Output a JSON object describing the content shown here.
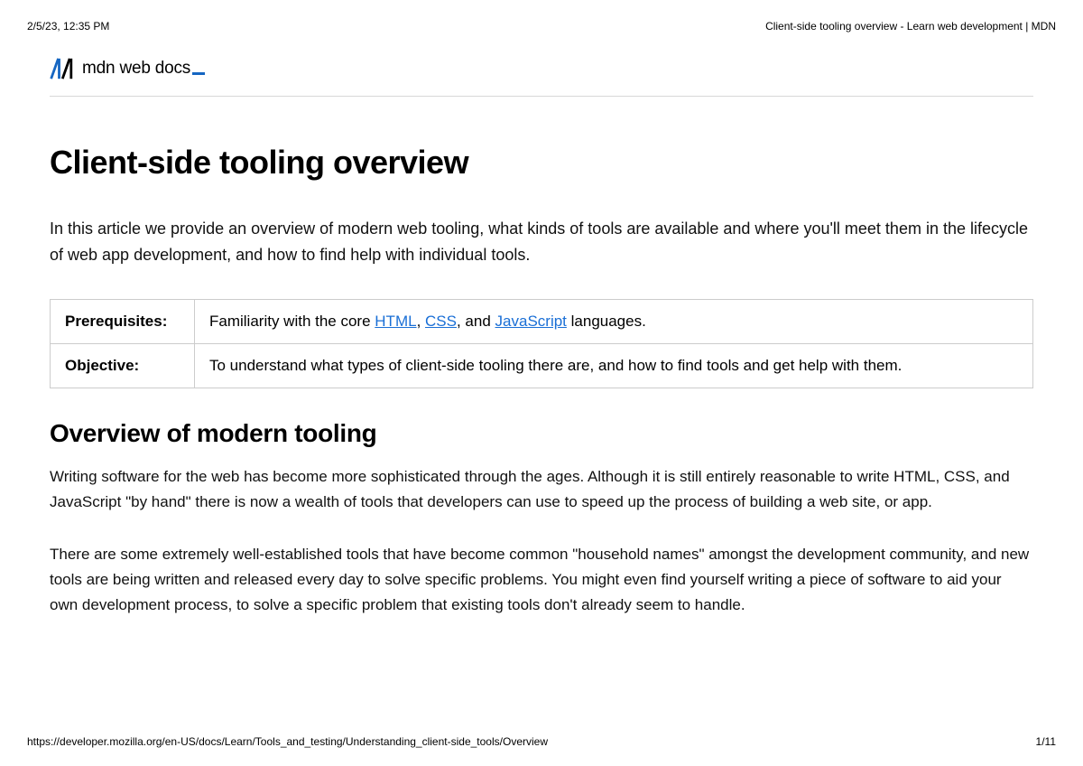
{
  "print_header": {
    "timestamp": "2/5/23, 12:35 PM",
    "doc_title": "Client-side tooling overview - Learn web development | MDN"
  },
  "brand": {
    "text": "mdn web docs"
  },
  "page": {
    "title": "Client-side tooling overview",
    "intro": "In this article we provide an overview of modern web tooling, what kinds of tools are available and where you'll meet them in the lifecycle of web app development, and how to find help with individual tools."
  },
  "info_table": {
    "prereq_label": "Prerequisites:",
    "prereq_prefix": "Familiarity with the core ",
    "prereq_link1": "HTML",
    "prereq_sep1": ", ",
    "prereq_link2": "CSS",
    "prereq_sep2": ", and ",
    "prereq_link3": "JavaScript",
    "prereq_suffix": " languages.",
    "objective_label": "Objective:",
    "objective_text": "To understand what types of client-side tooling there are, and how to find tools and get help with them."
  },
  "section": {
    "heading": "Overview of modern tooling",
    "para1": "Writing software for the web has become more sophisticated through the ages. Although it is still entirely reasonable to write HTML, CSS, and JavaScript \"by hand\" there is now a wealth of tools that developers can use to speed up the process of building a web site, or app.",
    "para2": "There are some extremely well-established tools that have become common \"household names\" amongst the development community, and new tools are being written and released every day to solve specific problems. You might even find yourself writing a piece of software to aid your own development process, to solve a specific problem that existing tools don't already seem to handle."
  },
  "print_footer": {
    "url": "https://developer.mozilla.org/en-US/docs/Learn/Tools_and_testing/Understanding_client-side_tools/Overview",
    "page_num": "1/11"
  }
}
